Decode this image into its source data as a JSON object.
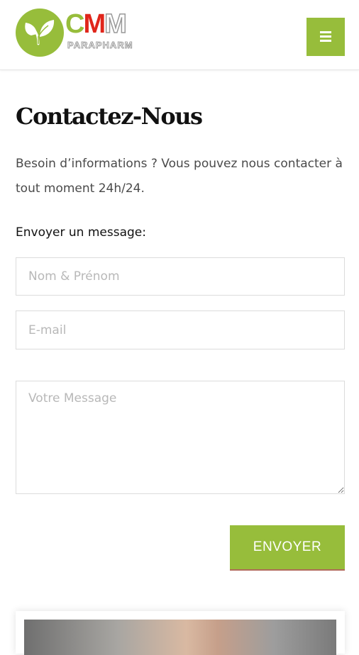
{
  "header": {
    "logo": {
      "letters": [
        "C",
        "M",
        "M"
      ],
      "subtitle": "PARAPHARM",
      "brand_color": "#97bd3b",
      "accent_color": "#e0261b"
    },
    "menu_icon": "hamburger-menu-icon"
  },
  "page": {
    "title": "Contactez-Nous",
    "intro": "Besoin d’informations ? Vous pouvez nous contacter à tout moment 24h/24."
  },
  "form": {
    "label": "Envoyer un message:",
    "name_placeholder": "Nom & Prénom",
    "email_placeholder": "E-mail",
    "message_placeholder": "Votre Message",
    "submit_label": "ENVOYER"
  },
  "colors": {
    "accent": "#97bd3b"
  }
}
